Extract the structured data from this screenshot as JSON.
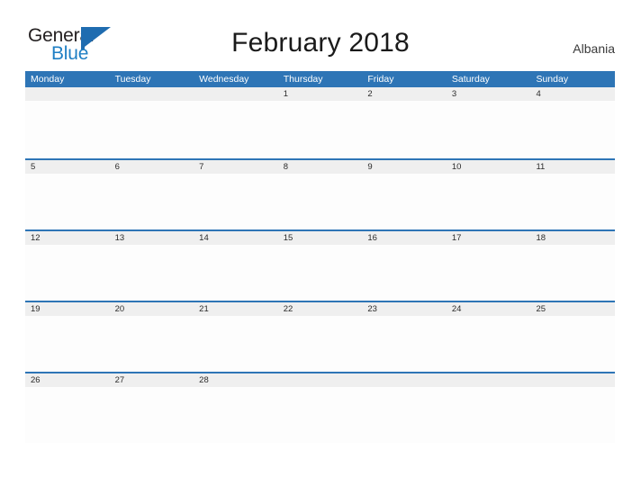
{
  "logo": {
    "text_primary": "General",
    "text_secondary": "Blue",
    "mark": "flag-triangle",
    "color_primary": "#231f20",
    "color_secondary": "#1f7fc4",
    "color_mark": "#1f6cb0"
  },
  "header": {
    "title": "February 2018",
    "country": "Albania"
  },
  "theme": {
    "header_blue": "#2e75b6",
    "row_divider_blue": "#2e75b6",
    "date_strip_gray": "#efefef",
    "cell_white": "#fdfdfd",
    "text_dark": "#1a1a1a"
  },
  "calendar": {
    "month": "February",
    "year": "2018",
    "weekday_headers": [
      "Monday",
      "Tuesday",
      "Wednesday",
      "Thursday",
      "Friday",
      "Saturday",
      "Sunday"
    ],
    "weeks": [
      [
        "",
        "",
        "",
        "1",
        "2",
        "3",
        "4"
      ],
      [
        "5",
        "6",
        "7",
        "8",
        "9",
        "10",
        "11"
      ],
      [
        "12",
        "13",
        "14",
        "15",
        "16",
        "17",
        "18"
      ],
      [
        "19",
        "20",
        "21",
        "22",
        "23",
        "24",
        "25"
      ],
      [
        "26",
        "27",
        "28",
        "",
        "",
        "",
        ""
      ]
    ]
  }
}
